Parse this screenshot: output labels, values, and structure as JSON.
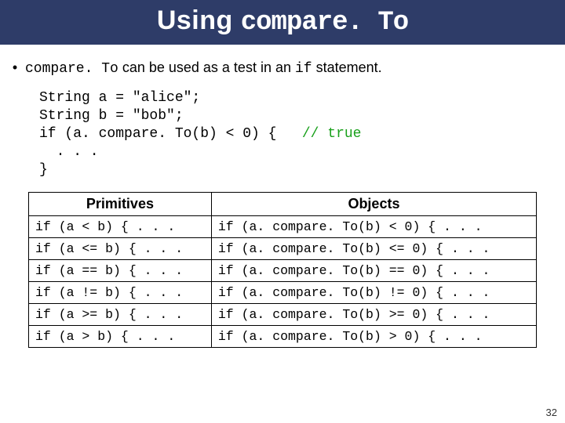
{
  "title": {
    "prefix": "Using ",
    "mono": "compare. To"
  },
  "bullet": {
    "pre": "compare. To",
    "rest": " can be used as a test in an ",
    "mono2": "if",
    "tail": " statement."
  },
  "code": {
    "line1": "String a = \"alice\";",
    "line2": "String b = \"bob\";",
    "line3a": "if (a. compare. To(b) < 0) {   ",
    "line3b": "// true",
    "line4": "  . . .",
    "line5": "}"
  },
  "table": {
    "head": {
      "left": "Primitives",
      "right": "Objects"
    },
    "rows": [
      {
        "prim": "if (a < b) { . . .",
        "obj": "if (a. compare. To(b) < 0) { . . ."
      },
      {
        "prim": "if (a <= b) { . . .",
        "obj": "if (a. compare. To(b) <= 0) { . . ."
      },
      {
        "prim": "if (a == b) { . . .",
        "obj": "if (a. compare. To(b) == 0) { . . ."
      },
      {
        "prim": "if (a != b) { . . .",
        "obj": "if (a. compare. To(b) != 0) { . . ."
      },
      {
        "prim": "if (a >= b) { . . .",
        "obj": "if (a. compare. To(b) >= 0) { . . ."
      },
      {
        "prim": "if (a > b) { . . .",
        "obj": "if (a. compare. To(b) > 0) { . . ."
      }
    ]
  },
  "page_number": "32"
}
